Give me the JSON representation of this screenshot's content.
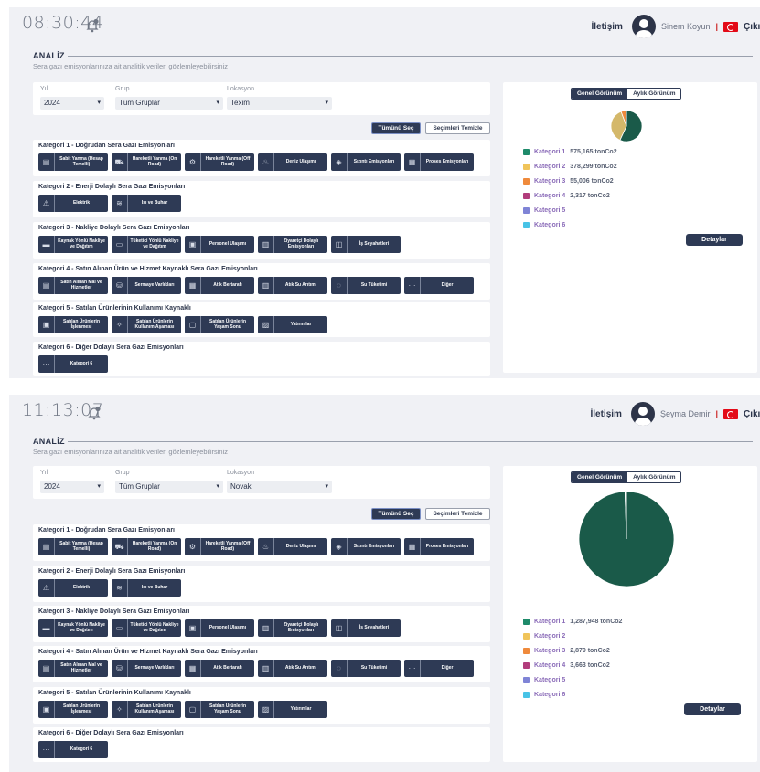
{
  "header": {
    "contact_label": "İletişim",
    "exit_label": "Çıkış",
    "flag": "turkey-flag"
  },
  "analysis": {
    "title": "ANALİZ",
    "subtitle": "Sera gazı emisyonlarınıza ait analitik verileri gözlemleyebilirsiniz"
  },
  "filters": {
    "year_label": "Yıl",
    "group_label": "Grup",
    "location_label": "Lokasyon"
  },
  "buttons": {
    "select_all": "Tümünü Seç",
    "clear": "Seçimleri Temizle",
    "details": "Detaylar"
  },
  "view_tabs": {
    "general": "Genel Görünüm",
    "monthly": "Aylık Görünüm"
  },
  "categories": [
    {
      "title": "Kategori 1 - Doğrudan Sera Gazı Emisyonları",
      "items": [
        {
          "icon": "building-icon",
          "label": "Sabit Yanma (Hesap Temelli)"
        },
        {
          "icon": "car-icon",
          "label": "Hareketli Yanma (On Road)"
        },
        {
          "icon": "tractor-icon",
          "label": "Hareketli Yanma (Off Road)"
        },
        {
          "icon": "vapor-icon",
          "label": "Deniz Ulaşımı"
        },
        {
          "icon": "leak-icon",
          "label": "Sızıntı Emisyonları"
        },
        {
          "icon": "factory-icon",
          "label": "Proses Emisyonları"
        }
      ]
    },
    {
      "title": "Kategori 2 - Enerji Dolaylı Sera Gazı Emisyonları",
      "items": [
        {
          "icon": "lightning-icon",
          "label": "Elektrik"
        },
        {
          "icon": "steam-icon",
          "label": "Isı ve Buhar"
        }
      ]
    },
    {
      "title": "Kategori 3 - Nakliye Dolaylı Sera Gazı Emisyonları",
      "items": [
        {
          "icon": "truck-icon",
          "label": "Kaynak Yönlü Nakliye ve Dağıtım"
        },
        {
          "icon": "van-icon",
          "label": "Tüketici Yönlü Nakliye ve Dağıtım"
        },
        {
          "icon": "bus-icon",
          "label": "Personel Ulaşımı"
        },
        {
          "icon": "visitor-icon",
          "label": "Ziyaretçi Dolaylı Emisyonları"
        },
        {
          "icon": "suitcase-icon",
          "label": "İş Seyahatleri"
        }
      ]
    },
    {
      "title": "Kategori 4 - Satın Alınan Ürün ve Hizmet Kaynaklı Sera Gazı Emisyonları",
      "items": [
        {
          "icon": "cart-icon",
          "label": "Satın Alınan Mal ve Hizmetler"
        },
        {
          "icon": "capital-icon",
          "label": "Sermaye Varlıkları"
        },
        {
          "icon": "waste-icon",
          "label": "Atık Bertarafı"
        },
        {
          "icon": "water-treatment-icon",
          "label": "Atık Su Arıtımı"
        },
        {
          "icon": "water-icon",
          "label": "Su Tüketimi"
        },
        {
          "icon": "ellipsis-icon",
          "label": "Diğer"
        }
      ]
    },
    {
      "title": "Kategori 5 - Satılan Ürünlerinin Kullanımı Kaynaklı",
      "items": [
        {
          "icon": "processing-icon",
          "label": "Satılan Ürünlerin İşlenmesi"
        },
        {
          "icon": "usage-icon",
          "label": "Satılan Ürünlerin Kullanım Aşaması"
        },
        {
          "icon": "bin-icon",
          "label": "Satılan Ürünlerin Yaşam Sonu"
        },
        {
          "icon": "investment-icon",
          "label": "Yatırımlar"
        }
      ]
    },
    {
      "title": "Kategori 6 - Diğer Dolaylı Sera Gazı Emisyonları",
      "items": [
        {
          "icon": "ellipsis-icon",
          "label": "Kategori 6"
        }
      ]
    }
  ],
  "legend_colors": [
    "#1e8a6a",
    "#f0c45a",
    "#ef8a3c",
    "#b23d7c",
    "#7f84d6",
    "#48c3e6"
  ],
  "legend_names": [
    "Kategori 1",
    "Kategori 2",
    "Kategori 3",
    "Kategori 4",
    "Kategori 5",
    "Kategori 6"
  ],
  "screens": [
    {
      "time": "08:30:44",
      "user_name": "Sinem Koyun",
      "year": "2024",
      "group": "Tüm Gruplar",
      "location": "Texim",
      "legend_values": [
        "575,165 tonCo2",
        "378,299 tonCo2",
        "55,006 tonCo2",
        "2,317 tonCo2",
        "",
        ""
      ],
      "chart_data": {
        "type": "pie",
        "labels": [
          "Kategori 1",
          "Kategori 2",
          "Kategori 3",
          "Kategori 4",
          "Kategori 5",
          "Kategori 6"
        ],
        "values": [
          575165,
          378299,
          55006,
          2317,
          0,
          0
        ],
        "unit": "tonCo2",
        "colors": [
          "#1a5a49",
          "#d4b86a",
          "#ef8a3c",
          "#b23d7c",
          "#7f84d6",
          "#48c3e6"
        ]
      }
    },
    {
      "time": "11:13:07",
      "user_name": "Şeyma Demir",
      "year": "2024",
      "group": "Tüm Gruplar",
      "location": "Novak",
      "legend_values": [
        "1,287,948 tonCo2",
        "",
        "2,879 tonCo2",
        "3,663 tonCo2",
        "",
        ""
      ],
      "chart_data": {
        "type": "pie",
        "labels": [
          "Kategori 1",
          "Kategori 2",
          "Kategori 3",
          "Kategori 4",
          "Kategori 5",
          "Kategori 6"
        ],
        "values": [
          1287948,
          0,
          2879,
          3663,
          0,
          0
        ],
        "unit": "tonCo2",
        "colors": [
          "#1a5a49",
          "#d4b86a",
          "#ef8a3c",
          "#b23d7c",
          "#7f84d6",
          "#48c3e6"
        ]
      }
    }
  ]
}
